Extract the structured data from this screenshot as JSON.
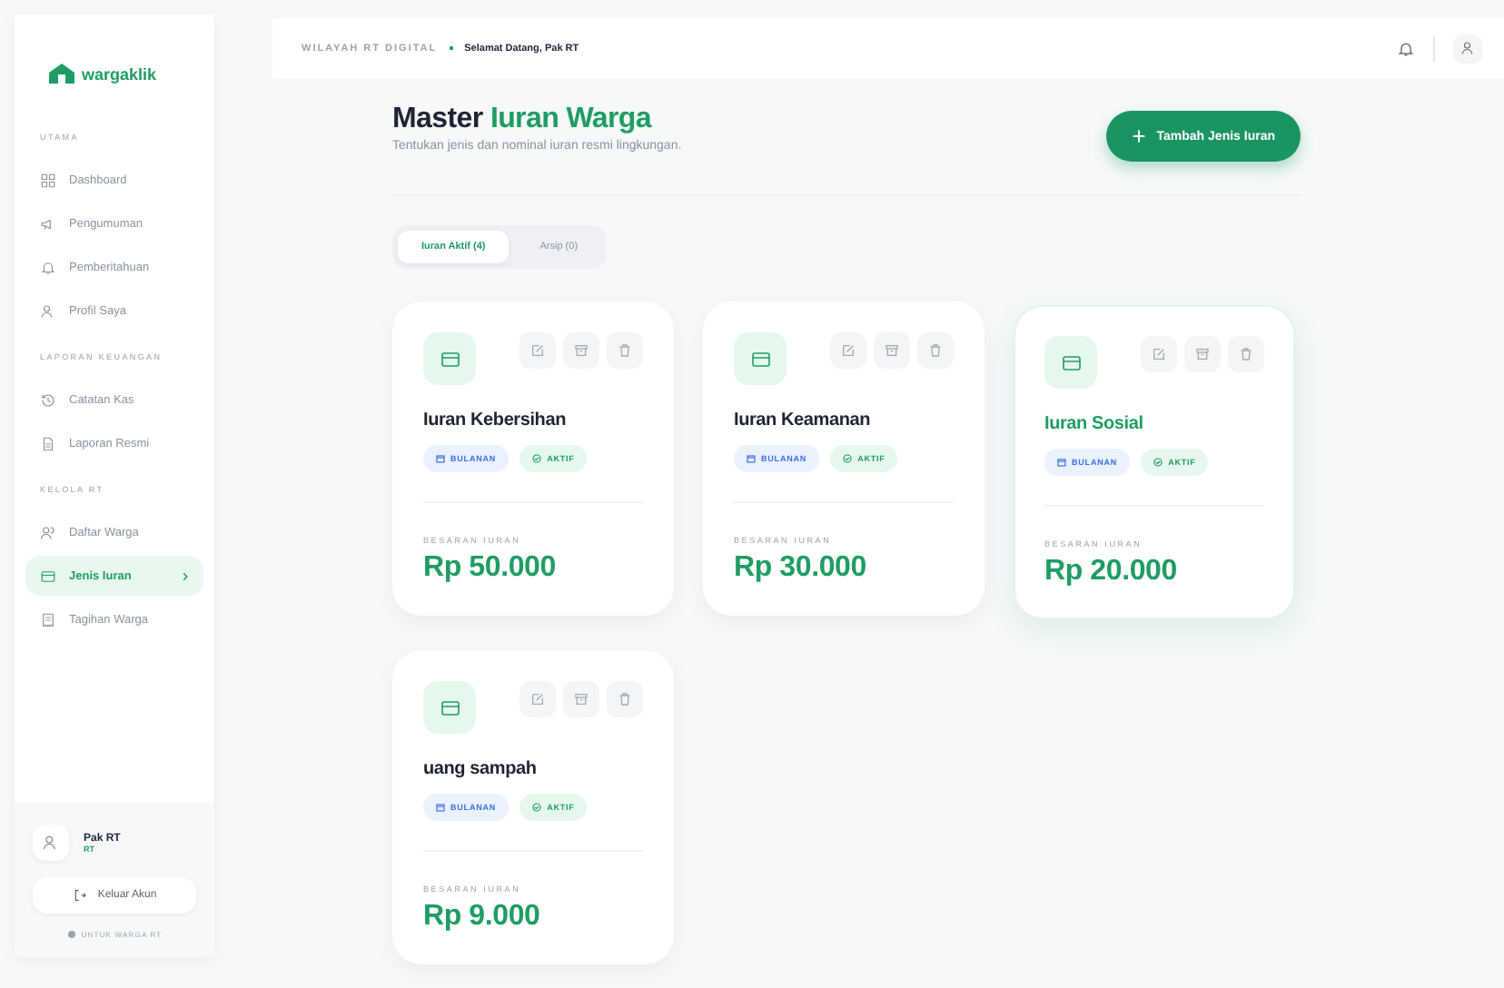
{
  "sidebar": {
    "logo": "wargaklik",
    "sections": [
      {
        "title": "UTAMA",
        "items": [
          {
            "label": "Dashboard",
            "kind": "grid",
            "selected": false
          },
          {
            "label": "Pengumuman",
            "kind": "megaphone",
            "selected": false
          },
          {
            "label": "Pemberitahuan",
            "kind": "bell",
            "selected": false
          },
          {
            "label": "Profil Saya",
            "kind": "user",
            "selected": false
          }
        ]
      },
      {
        "title": "LAPORAN KEUANGAN",
        "items": [
          {
            "label": "Catatan Kas",
            "kind": "history",
            "selected": false
          },
          {
            "label": "Laporan Resmi",
            "kind": "file",
            "selected": false
          }
        ]
      },
      {
        "title": "KELOLA RT",
        "items": [
          {
            "label": "Daftar Warga",
            "kind": "users",
            "selected": false
          },
          {
            "label": "Jenis Iuran",
            "kind": "card",
            "selected": true
          },
          {
            "label": "Tagihan Warga",
            "kind": "receipt",
            "selected": false
          }
        ]
      }
    ],
    "user": {
      "name": "Pak RT",
      "role": "RT"
    },
    "logout": "Keluar Akun",
    "footer": "UNTUK WARGA RT"
  },
  "header": {
    "breadcrumb": [
      "WILAYAH RT DIGITAL",
      "Selamat Datang, Pak RT"
    ]
  },
  "page": {
    "title": "Master",
    "title_accent": "Iuran Warga",
    "subtitle": "Tentukan jenis dan nominal iuran resmi lingkungan.",
    "add_button": "Tambah Jenis Iuran"
  },
  "tabs": [
    {
      "label": "Iuran Aktif (4)",
      "selected": true
    },
    {
      "label": "Arsip (0)",
      "selected": false
    }
  ],
  "cards": [
    {
      "name": "Iuran Kebersihan",
      "period": "BULANAN",
      "status": "AKTIF",
      "amount_label": "BESARAN IURAN",
      "amount": "Rp 50.000",
      "highlighted": false
    },
    {
      "name": "Iuran Keamanan",
      "period": "BULANAN",
      "status": "AKTIF",
      "amount_label": "BESARAN IURAN",
      "amount": "Rp 30.000",
      "highlighted": false
    },
    {
      "name": "Iuran Sosial",
      "period": "BULANAN",
      "status": "AKTIF",
      "amount_label": "BESARAN IURAN",
      "amount": "Rp 20.000",
      "highlighted": true
    },
    {
      "name": "uang sampah",
      "period": "BULANAN",
      "status": "AKTIF",
      "amount_label": "BESARAN IURAN",
      "amount": "Rp 9.000",
      "highlighted": false
    }
  ]
}
